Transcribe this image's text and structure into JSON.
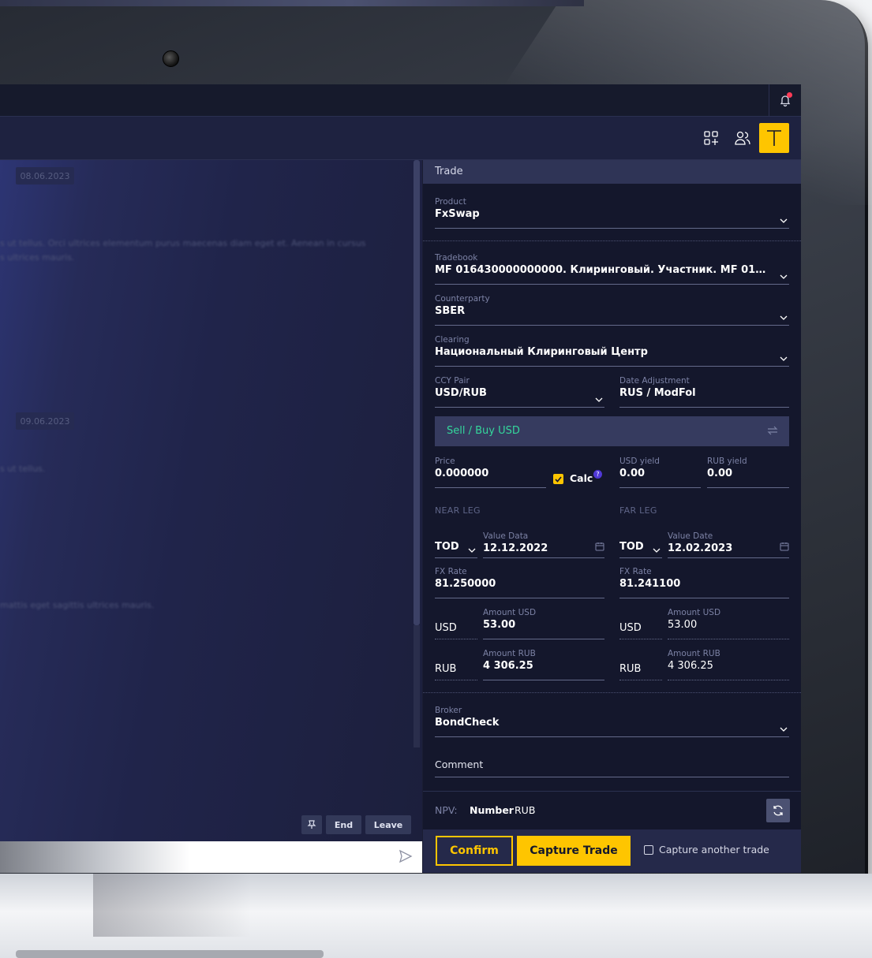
{
  "chat": {
    "dates": [
      "08.06.2023",
      "09.06.2023"
    ],
    "messages": [
      "s ut tellus. Orci ultrices elementum purus maecenas diam eget et. Aenean in cursus",
      "s ultrices mauris.",
      "s ut tellus.",
      "mattis eget sagittis ultrices mauris."
    ],
    "buttons": {
      "end": "End",
      "leave": "Leave"
    }
  },
  "trade": {
    "header": "Trade",
    "product": {
      "label": "Product",
      "value": "FxSwap"
    },
    "tradebook": {
      "label": "Tradebook",
      "value": "MF 016430000000000. Клиринговый. Участник. MF 016430000..."
    },
    "counterparty": {
      "label": "Counterparty",
      "value": "SBER"
    },
    "clearing": {
      "label": "Clearing",
      "value": "Национальный Клиринговый Центр"
    },
    "ccy_pair": {
      "label": "CCY Pair",
      "value": "USD/RUB"
    },
    "date_adjustment": {
      "label": "Date Adjustment",
      "value": "RUS / ModFol"
    },
    "direction": "Sell / Buy USD",
    "price": {
      "label": "Price",
      "value": "0.000000"
    },
    "calc": {
      "label": "Calc",
      "checked": true,
      "help": "?"
    },
    "usd_yield": {
      "label": "USD yield",
      "value": "0.00"
    },
    "rub_yield": {
      "label": "RUB yield",
      "value": "0.00"
    },
    "near_leg": {
      "title": "NEAR LEG",
      "tenor": "TOD",
      "value_date_label": "Value Data",
      "value_date": "12.12.2022",
      "fx_rate_label": "FX Rate",
      "fx_rate": "81.250000",
      "amount_usd_label": "Amount USD",
      "usd_ccy": "USD",
      "amount_usd": "53.00",
      "amount_rub_label": "Amount RUB",
      "rub_ccy": "RUB",
      "amount_rub": "4 306.25"
    },
    "far_leg": {
      "title": "FAR LEG",
      "tenor": "TOD",
      "value_date_label": "Value Date",
      "value_date": "12.02.2023",
      "fx_rate_label": "FX Rate",
      "fx_rate": "81.241100",
      "amount_usd_label": "Amount USD",
      "usd_ccy": "USD",
      "amount_usd": "53.00",
      "amount_rub_label": "Amount RUB",
      "rub_ccy": "RUB",
      "amount_rub": "4 306.25"
    },
    "broker": {
      "label": "Broker",
      "value": "BondCheck"
    },
    "comment": {
      "label": "Comment"
    },
    "npv": {
      "label": "NPV:",
      "value": "Number",
      "ccy": "RUB"
    },
    "confirm_label": "Confirm",
    "capture_label": "Capture Trade",
    "capture_another_label": "Capture another trade",
    "capture_another_checked": false
  },
  "colors": {
    "accent": "#fec500",
    "direction_text": "#34d79c",
    "notification_dot": "#ff3b57",
    "panel_bg": "#14172c"
  },
  "icons": [
    "bell-icon",
    "apps-add-icon",
    "users-icon",
    "trade-t-icon",
    "chevron-down-icon",
    "swap-icon",
    "calendar-icon",
    "refresh-icon",
    "send-icon",
    "pin-icon"
  ]
}
